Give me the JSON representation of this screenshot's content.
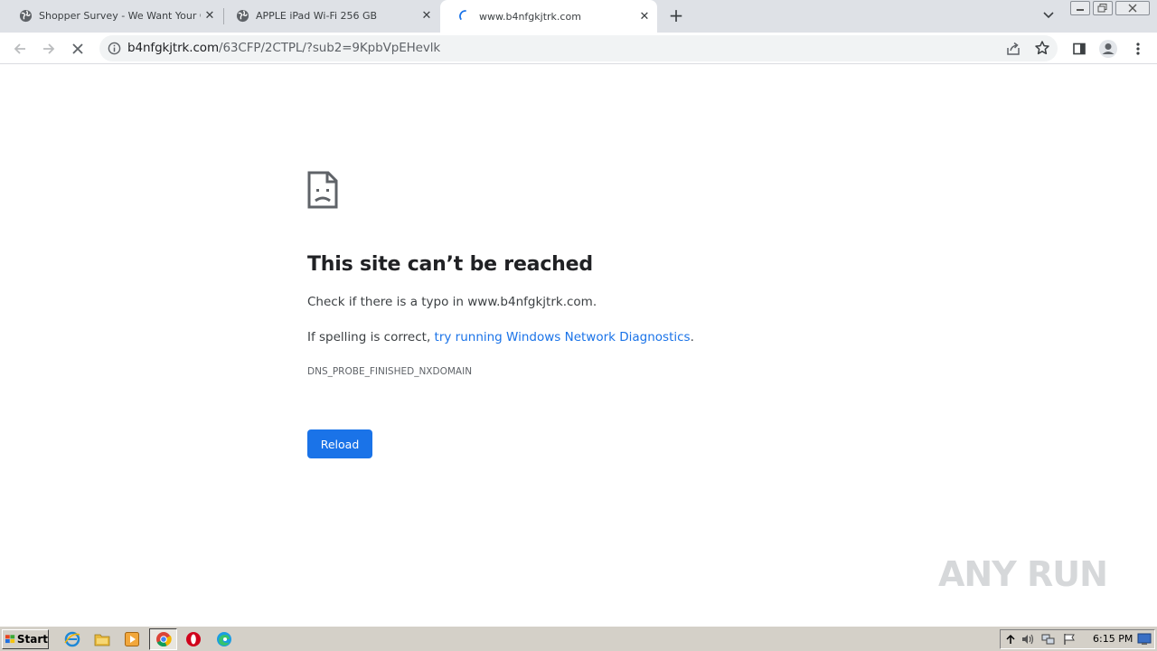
{
  "tabs": [
    {
      "title": "Shopper Survey - We Want Your Op",
      "favicon": "globe-icon",
      "active": false
    },
    {
      "title": "APPLE iPad Wi-Fi 256 GB",
      "favicon": "globe-icon",
      "active": false
    },
    {
      "title": "www.b4nfgkjtrk.com",
      "favicon": "loading-spinner-icon",
      "active": true
    }
  ],
  "omnibox": {
    "host": "b4nfgkjtrk.com",
    "path": "/63CFP/2CTPL/?sub2=9KpbVpEHevlk"
  },
  "error_page": {
    "title": "This site can’t be reached",
    "line1": "Check if there is a typo in www.b4nfgkjtrk.com.",
    "line2_prefix": "If spelling is correct, ",
    "line2_link": "try running Windows Network Diagnostics",
    "line2_suffix": ".",
    "code": "DNS_PROBE_FINISHED_NXDOMAIN",
    "reload_label": "Reload"
  },
  "watermark": "ANY RUN",
  "taskbar": {
    "start_label": "Start",
    "clock": "6:15 PM"
  },
  "colors": {
    "accent": "#1a73e8",
    "tabstrip": "#dee1e6",
    "taskbar": "#d4d0c8"
  }
}
